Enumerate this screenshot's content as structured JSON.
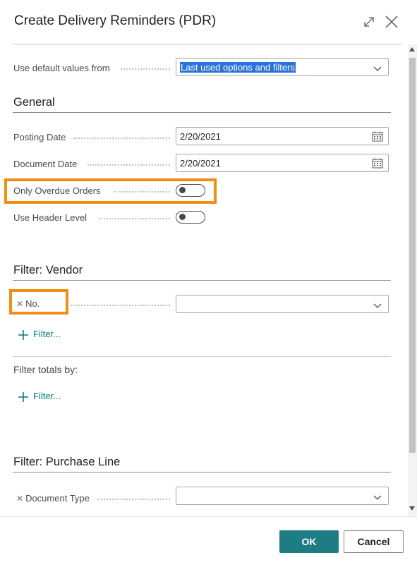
{
  "dialog": {
    "title": "Create Delivery Reminders (PDR)",
    "expand_icon": "expand-icon",
    "close_icon": "close-icon"
  },
  "defaults": {
    "label": "Use default values from",
    "value": "Last used options and filters"
  },
  "general": {
    "heading": "General",
    "posting_date_label": "Posting Date",
    "posting_date_value": "2/20/2021",
    "document_date_label": "Document Date",
    "document_date_value": "2/20/2021",
    "only_overdue_label": "Only Overdue Orders",
    "only_overdue_value": false,
    "header_level_label": "Use Header Level",
    "header_level_value": false
  },
  "filter_vendor": {
    "heading": "Filter: Vendor",
    "no_label": "No.",
    "no_value": "",
    "add_filter_label": "Filter...",
    "totals_label": "Filter totals by:",
    "totals_add_filter_label": "Filter..."
  },
  "filter_purchase_line": {
    "heading": "Filter: Purchase Line",
    "document_type_label": "Document Type",
    "document_type_value": ""
  },
  "footer": {
    "ok_label": "OK",
    "cancel_label": "Cancel"
  },
  "colors": {
    "accent": "#1e7d82",
    "highlight": "#f28c13",
    "link": "#00787a",
    "selection": "#2a73d9"
  }
}
